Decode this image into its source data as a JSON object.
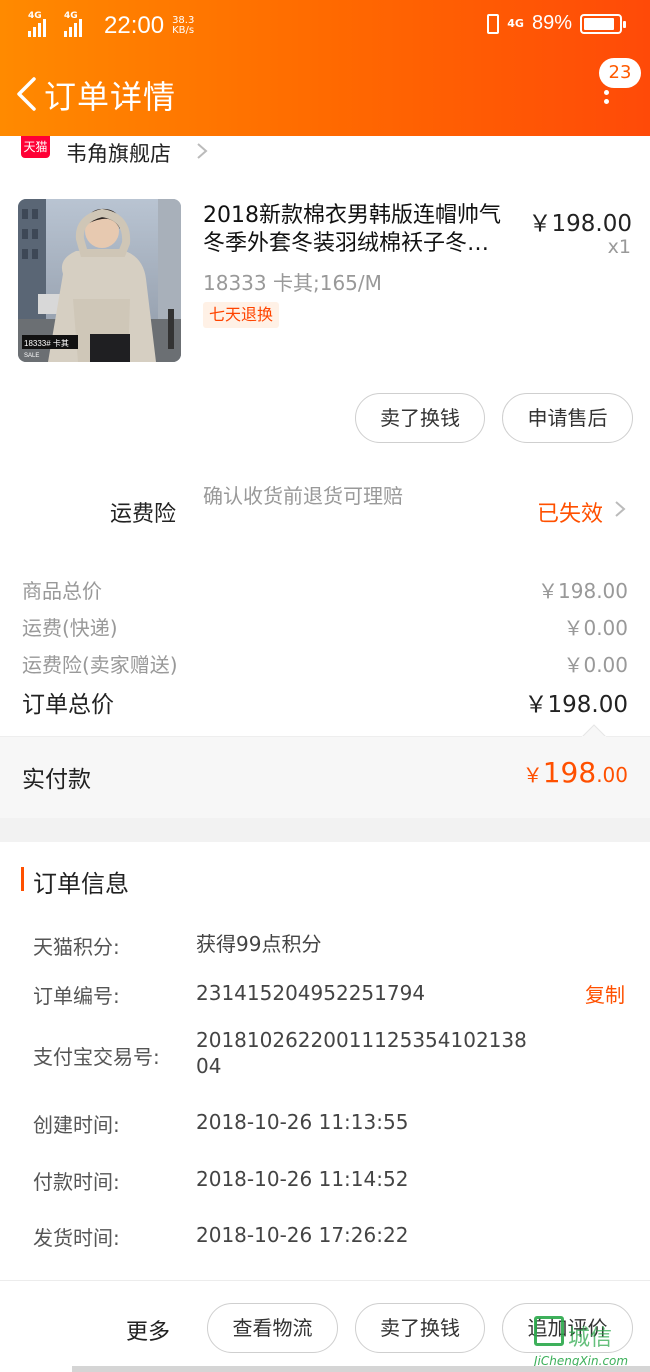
{
  "status_bar": {
    "net1": "4G",
    "net1_sup": "HD",
    "net2": "4G",
    "time": "22:00",
    "speed_value": "38.3",
    "speed_unit": "KB/s",
    "net3": "4G",
    "battery": "89%",
    "battery_level": 0.89
  },
  "header": {
    "title": "订单详情",
    "badge_count": "23"
  },
  "shop": {
    "logo_text": "天猫",
    "name": "韦角旗舰店"
  },
  "product": {
    "title": "2018新款棉衣男韩版连帽帅气冬季外套冬装羽绒棉袄子冬…",
    "price": "￥198.00",
    "quantity": "x1",
    "sku": "18333 卡其;165/M",
    "tag": "七天退换",
    "img_label": "18333# 卡其",
    "img_sub": "SALE"
  },
  "item_actions": {
    "sell_exchange": "卖了换钱",
    "after_sale": "申请售后"
  },
  "insurance": {
    "label": "运费险",
    "desc": "确认收货前退货可理赔",
    "status": "已失效"
  },
  "price_summary": {
    "goods_total_label": "商品总价",
    "goods_total_value": "￥198.00",
    "shipping_label": "运费(快递)",
    "shipping_value": "￥0.00",
    "insurance_label": "运费险(卖家赠送)",
    "insurance_value": "￥0.00",
    "order_total_label": "订单总价",
    "order_total_value": "￥198.00"
  },
  "paid": {
    "label": "实付款",
    "currency": "￥",
    "integer": "198",
    "decimal": ".00"
  },
  "order_info": {
    "section_title": "订单信息",
    "rows": [
      {
        "key": "天猫积分:",
        "value": "获得99点积分"
      },
      {
        "key": "订单编号:",
        "value": "231415204952251794"
      },
      {
        "key": "支付宝交易号:",
        "value": "2018102622001112535410213804"
      },
      {
        "key": "创建时间:",
        "value": "2018-10-26 11:13:55"
      },
      {
        "key": "付款时间:",
        "value": "2018-10-26 11:14:52"
      },
      {
        "key": "发货时间:",
        "value": "2018-10-26 17:26:22"
      }
    ],
    "copy_label": "复制"
  },
  "bottom_bar": {
    "more": "更多",
    "logistics": "查看物流",
    "sell_exchange": "卖了换钱",
    "add_review": "追加评价"
  },
  "watermark": {
    "text": "城信",
    "sub": "JiChengXin.com"
  },
  "colors": {
    "header_gradient_start": "#ff8a00",
    "header_gradient_end": "#ff4a08",
    "accent": "#ff5000",
    "tmall_red": "#ff0036"
  }
}
